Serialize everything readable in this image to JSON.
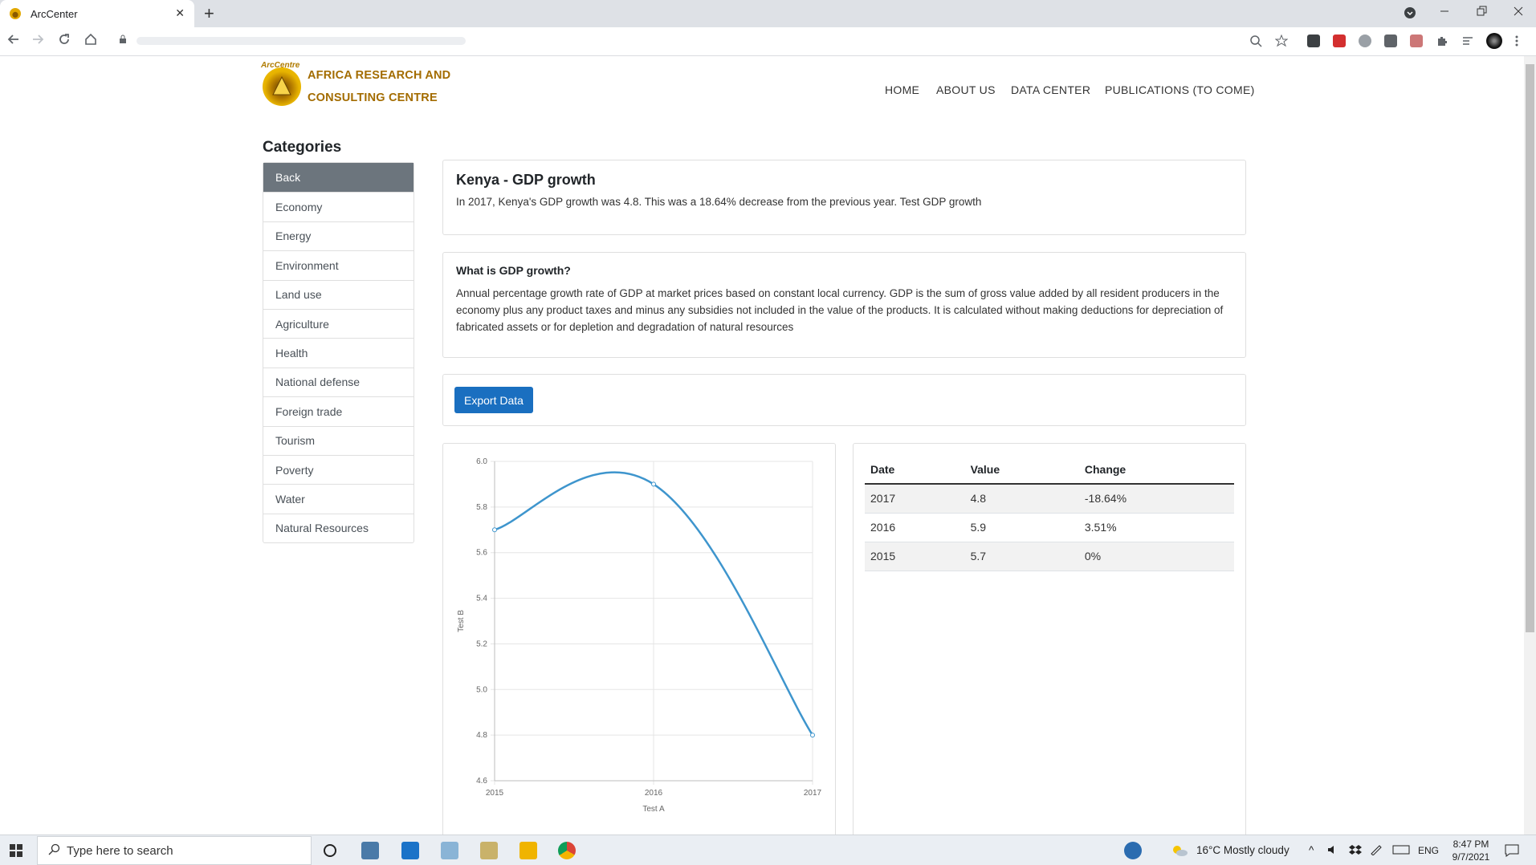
{
  "browser": {
    "tab_title": "ArcCenter",
    "new_tab": "+",
    "close_tab": "✕"
  },
  "site": {
    "logo_arc": "ArcCentre",
    "logo_line1": "AFRICA RESEARCH AND",
    "logo_line2": "CONSULTING CENTRE",
    "nav": [
      "HOME",
      "ABOUT US",
      "DATA CENTER",
      "PUBLICATIONS (TO COME)"
    ]
  },
  "sidebar": {
    "title": "Categories",
    "items": [
      "Back",
      "Economy",
      "Energy",
      "Environment",
      "Land use",
      "Agriculture",
      "Health",
      "National defense",
      "Foreign trade",
      "Tourism",
      "Poverty",
      "Water",
      "Natural Resources"
    ]
  },
  "indicator": {
    "title": "Kenya - GDP growth",
    "summary": "In 2017,  Kenya's GDP growth was 4.8.  This was a 18.64% decrease  from the previous year.  Test GDP growth"
  },
  "definition": {
    "title": "What is GDP growth?",
    "text": "Annual percentage growth rate of GDP at market prices based on constant local currency. GDP is the sum of gross value added by all resident producers in the economy plus any product taxes and minus any subsidies not included in the value of the products. It is calculated without making deductions for depreciation of fabricated assets or for depletion and degradation of natural resources"
  },
  "actions": {
    "export_label": "Export Data"
  },
  "table": {
    "headers": [
      "Date",
      "Value",
      "Change"
    ],
    "rows": [
      [
        "2017",
        "4.8",
        "-18.64%"
      ],
      [
        "2016",
        "5.9",
        "3.51%"
      ],
      [
        "2015",
        "5.7",
        "0%"
      ]
    ]
  },
  "chart_data": {
    "type": "line",
    "x": [
      "2015",
      "2016",
      "2017"
    ],
    "series": [
      {
        "values": [
          5.7,
          5.9,
          4.8
        ],
        "color": "#3e95cd"
      }
    ],
    "xlabel": "Test A",
    "ylabel": "Test B",
    "ylim": [
      4.6,
      6.0
    ],
    "yticks": [
      "6.0",
      "5.8",
      "5.6",
      "5.4",
      "5.2",
      "5.0",
      "4.8",
      "4.6"
    ],
    "grid": true,
    "smooth": true
  },
  "taskbar": {
    "search_placeholder": "Type here to search",
    "weather": "16°C  Mostly cloudy",
    "lang": "ENG",
    "time": "8:47 PM",
    "date": "9/7/2021"
  },
  "colors": {
    "accent": "#1a6fc0",
    "active_category": "#6c757d",
    "logo_gold": "#a36c00"
  }
}
